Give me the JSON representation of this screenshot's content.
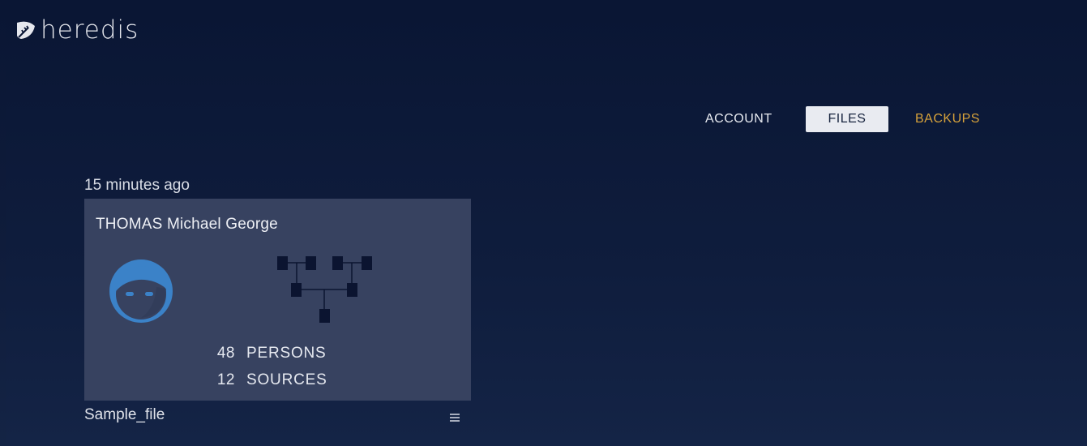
{
  "app": {
    "logo_text": "heredis",
    "logo_icon": "leaf-icon"
  },
  "nav": {
    "account_label": "ACCOUNT",
    "files_label": "FILES",
    "backups_label": "BACKUPS",
    "active_tab": "FILES"
  },
  "file": {
    "timestamp": "15 minutes ago",
    "root_person": "THOMAS Michael George",
    "persons_count": "48",
    "persons_label": "PERSONS",
    "sources_count": "12",
    "sources_label": "SOURCES",
    "name": "Sample_file",
    "avatar_icon": "person-avatar-icon",
    "tree_icon": "family-tree-icon",
    "menu_icon": "hamburger-menu-icon"
  },
  "colors": {
    "background": "#0f1c3b",
    "card": "#374260",
    "accent": "#d7a23b",
    "avatar_blue": "#3b82c8",
    "tab_active_bg": "#e9ebf1"
  }
}
